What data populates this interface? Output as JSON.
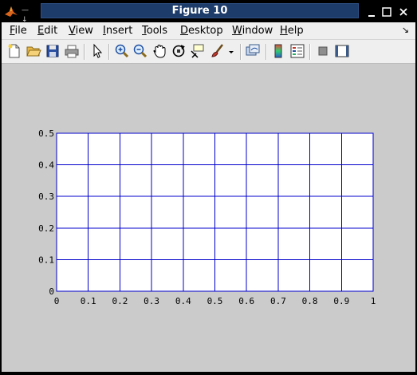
{
  "window": {
    "title": "Figure 10",
    "system_menu_glyph": "—↓"
  },
  "menu": {
    "items": [
      {
        "label": "File",
        "accel": "F",
        "rest": "ile"
      },
      {
        "label": "Edit",
        "accel": "E",
        "rest": "dit"
      },
      {
        "label": "View",
        "accel": "V",
        "rest": "iew"
      },
      {
        "label": "Insert",
        "accel": "I",
        "rest": "nsert"
      },
      {
        "label": "Tools",
        "accel": "T",
        "rest": "ools"
      },
      {
        "label": "Desktop",
        "accel": "D",
        "rest": "esktop"
      },
      {
        "label": "Window",
        "accel": "W",
        "rest": "indow"
      },
      {
        "label": "Help",
        "accel": "H",
        "rest": "elp"
      }
    ],
    "overflow_glyph": "↘"
  },
  "toolbar": {
    "icons": [
      "new-figure-icon",
      "open-file-icon",
      "save-icon",
      "print-icon",
      "edit-plot-icon",
      "zoom-in-icon",
      "zoom-out-icon",
      "pan-icon",
      "rotate-3d-icon",
      "data-cursor-icon",
      "brush-icon",
      "brush-dropdown-icon",
      "link-plot-icon",
      "insert-colorbar-icon",
      "insert-legend-icon",
      "hide-plot-tools-icon",
      "show-plot-tools-icon"
    ]
  },
  "chart_data": {
    "type": "line",
    "title": "",
    "xlabel": "",
    "ylabel": "",
    "xlim": [
      0,
      1
    ],
    "ylim": [
      0,
      0.5
    ],
    "x_ticks": [
      "0",
      "0.1",
      "0.2",
      "0.3",
      "0.4",
      "0.5",
      "0.6",
      "0.7",
      "0.8",
      "0.9",
      "1"
    ],
    "y_ticks": [
      "0",
      "0.1",
      "0.2",
      "0.3",
      "0.4",
      "0.5"
    ],
    "grid": true,
    "series": [],
    "colors": {
      "axes": "#0000cc",
      "grid": "#0000cc",
      "background": "#ffffff",
      "figure": "#cbcbcb"
    }
  }
}
